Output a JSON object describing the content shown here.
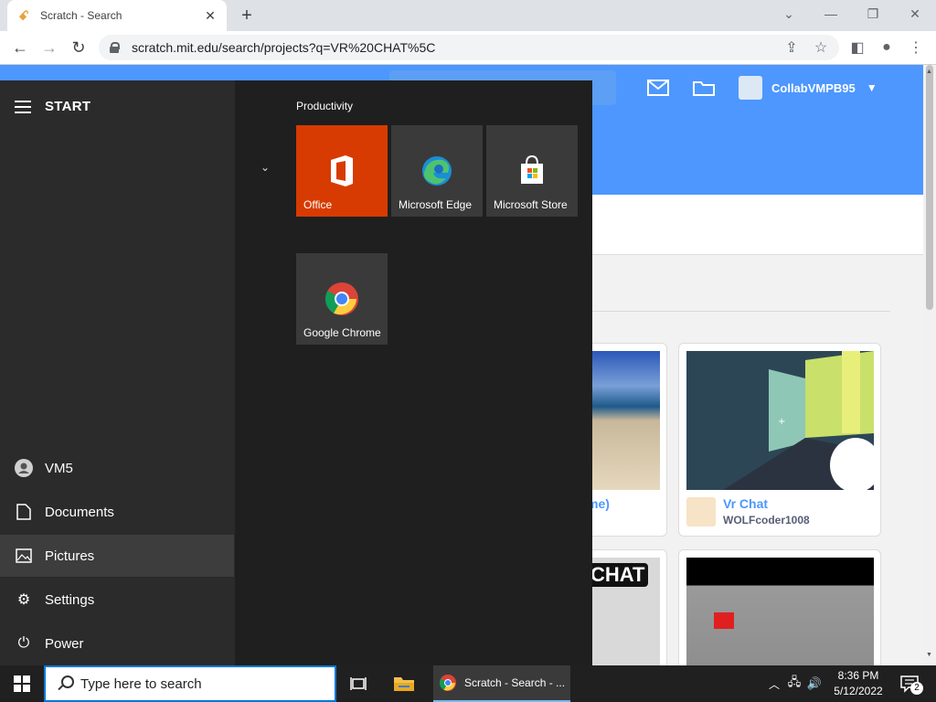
{
  "browser": {
    "tab_title": "Scratch - Search",
    "new_tab_icon": "plus-icon",
    "url": "scratch.mit.edu/search/projects?q=VR%20CHAT%5C"
  },
  "scratch": {
    "username": "CollabVMPB95",
    "cards": [
      {
        "title": "me)",
        "author": ""
      },
      {
        "title": "Vr Chat",
        "author": "WOLFcoder1008"
      }
    ],
    "thumb_text": "CHAT"
  },
  "start_menu": {
    "title": "START",
    "user": "VM5",
    "items": [
      {
        "label": "Documents",
        "icon": "document-icon"
      },
      {
        "label": "Pictures",
        "icon": "pictures-icon"
      },
      {
        "label": "Settings",
        "icon": "gear-icon"
      },
      {
        "label": "Power",
        "icon": "power-icon"
      }
    ],
    "group_label": "Productivity",
    "tiles": [
      {
        "label": "Office",
        "color": "#d83b01"
      },
      {
        "label": "Microsoft Edge",
        "color": "#3a3a3a"
      },
      {
        "label": "Microsoft Store",
        "color": "#3a3a3a"
      },
      {
        "label": "Google Chrome",
        "color": "#3a3a3a"
      }
    ]
  },
  "taskbar": {
    "search_placeholder": "Type here to search",
    "chrome_task_label": "Scratch - Search - ...",
    "time": "8:36 PM",
    "date": "5/12/2022",
    "notification_count": "2"
  }
}
